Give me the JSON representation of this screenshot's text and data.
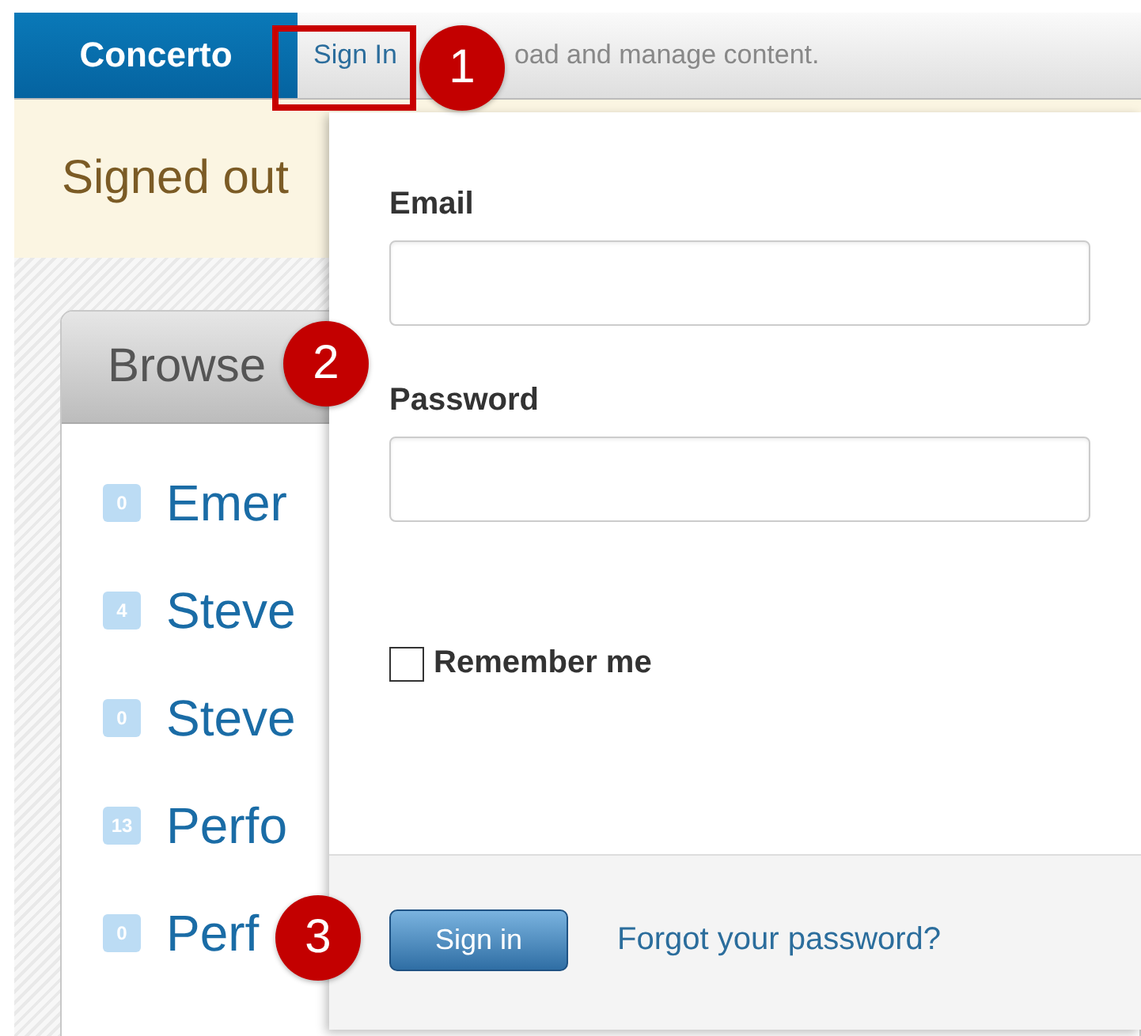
{
  "header": {
    "logo": "Concerto",
    "sign_in_link": "Sign In",
    "sign_in_highlighted": true,
    "tagline": "oad and manage content."
  },
  "notice": {
    "text": "Signed out"
  },
  "browse": {
    "title": "Browse",
    "feeds": [
      {
        "count": "0",
        "name": "Emer"
      },
      {
        "count": "4",
        "name": "Steve"
      },
      {
        "count": "0",
        "name": "Steve"
      },
      {
        "count": "13",
        "name": "Perfo"
      },
      {
        "count": "0",
        "name": "Perf"
      }
    ]
  },
  "sign_in_form": {
    "fields": [
      {
        "label": "Email"
      },
      {
        "label": "Password"
      }
    ],
    "remember_me": {
      "label": "Remember me",
      "checked": false
    },
    "submit": "Sign in",
    "forgot_link": "Forgot your password?"
  },
  "annotations": [
    {
      "number": "1"
    },
    {
      "number": "2"
    },
    {
      "number": "3"
    }
  ]
}
